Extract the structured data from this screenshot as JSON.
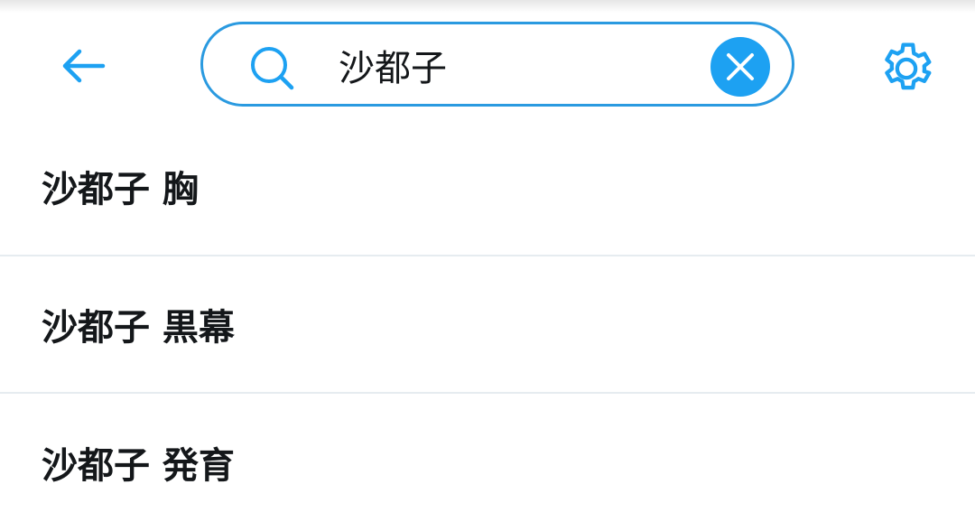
{
  "search": {
    "value": "沙都子",
    "back_icon": "arrow-left-icon",
    "search_icon": "search-icon",
    "clear_icon": "close-icon",
    "settings_icon": "gear-icon"
  },
  "suggestions": [
    {
      "label": "沙都子 胸"
    },
    {
      "label": "沙都子 黒幕"
    },
    {
      "label": "沙都子 発育"
    }
  ],
  "colors": {
    "accent": "#1da1f2",
    "border": "#2a9ae0",
    "text": "#14171a",
    "divider": "#e6ecf0"
  }
}
